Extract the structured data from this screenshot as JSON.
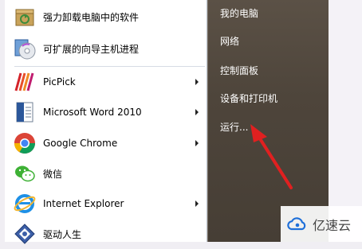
{
  "left_menu": {
    "items": [
      {
        "label": "强力卸载电脑中的软件",
        "icon": "uninstall-box-icon",
        "has_submenu": false
      },
      {
        "label": "可扩展的向导主机进程",
        "icon": "wizard-disc-icon",
        "has_submenu": false
      },
      {
        "label": "PicPick",
        "icon": "picpick-icon",
        "has_submenu": true
      },
      {
        "label": "Microsoft Word 2010",
        "icon": "word-document-icon",
        "has_submenu": true
      },
      {
        "label": "Google Chrome",
        "icon": "chrome-icon",
        "has_submenu": true
      },
      {
        "label": "微信",
        "icon": "wechat-icon",
        "has_submenu": false
      },
      {
        "label": "Internet Explorer",
        "icon": "internet-explorer-icon",
        "has_submenu": true
      },
      {
        "label": "驱动人生",
        "icon": "driver-life-icon",
        "has_submenu": false
      }
    ]
  },
  "right_menu": {
    "items": [
      "我的电脑",
      "网络",
      "控制面板",
      "设备和打印机",
      "运行..."
    ]
  },
  "watermark": {
    "text": "亿速云",
    "icon": "yisu-cloud-logo-icon"
  },
  "colors": {
    "right_panel": "#4e453b",
    "arrow": "#e02020",
    "accent_blue": "#1e6fd9"
  }
}
